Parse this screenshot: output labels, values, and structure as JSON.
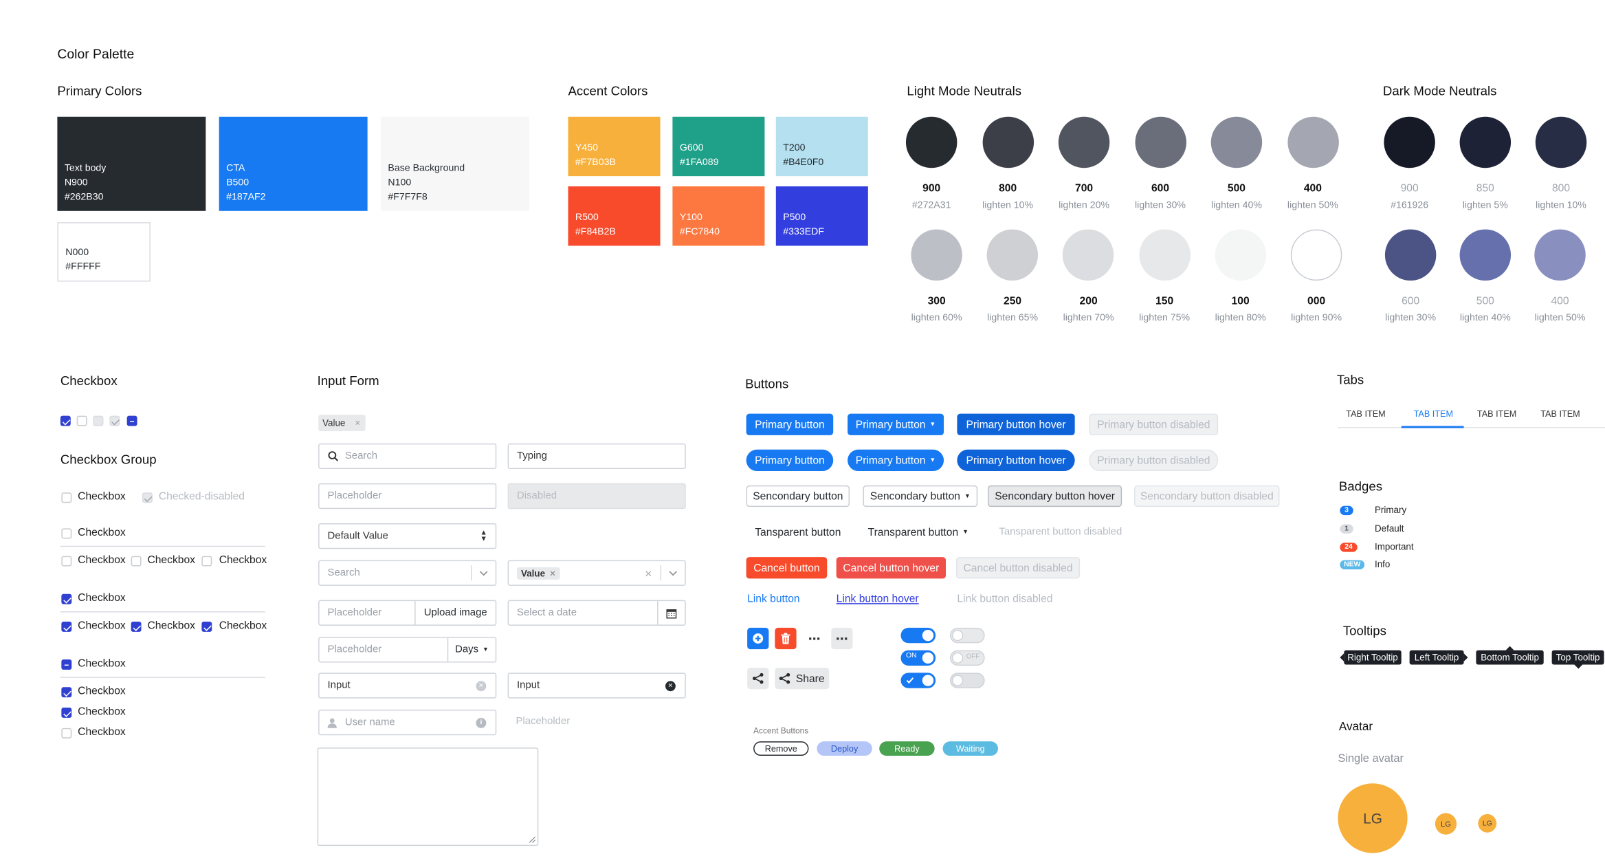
{
  "palette_title": "Color Palette",
  "primary": {
    "title": "Primary Colors",
    "swatches": [
      {
        "name": "Text body",
        "code": "N900",
        "hex": "#262B30"
      },
      {
        "name": "CTA",
        "code": "B500",
        "hex": "#187AF2"
      },
      {
        "name": "Base Background",
        "code": "N100",
        "hex": "#F7F7F8"
      },
      {
        "name": "",
        "code": "N000",
        "hex": "#FFFFF"
      }
    ]
  },
  "accent": {
    "title": "Accent Colors",
    "swatches": [
      {
        "code": "Y450",
        "hex": "#F7B03B"
      },
      {
        "code": "G600",
        "hex": "#1FA089"
      },
      {
        "code": "T200",
        "hex": "#B4E0F0"
      },
      {
        "code": "R500",
        "hex": "#F84B2B"
      },
      {
        "code": "Y100",
        "hex": "#FC7840"
      },
      {
        "code": "P500",
        "hex": "#333EDF"
      }
    ]
  },
  "light_neutrals": {
    "title": "Light Mode Neutrals",
    "items": [
      {
        "label": "900",
        "sub": "#272A31",
        "color": "#262B30"
      },
      {
        "label": "800",
        "sub": "lighten 10%",
        "color": "#3C3F47"
      },
      {
        "label": "700",
        "sub": "lighten 20%",
        "color": "#51555F"
      },
      {
        "label": "600",
        "sub": "lighten 30%",
        "color": "#6A6E7A"
      },
      {
        "label": "500",
        "sub": "lighten 40%",
        "color": "#878B99"
      },
      {
        "label": "400",
        "sub": "lighten 50%",
        "color": "#A4A7B1"
      },
      {
        "label": "300",
        "sub": "lighten 60%",
        "color": "#BDBFC6"
      },
      {
        "label": "250",
        "sub": "lighten 65%",
        "color": "#CFD0D4"
      },
      {
        "label": "200",
        "sub": "lighten 70%",
        "color": "#DCDDE0"
      },
      {
        "label": "150",
        "sub": "lighten 75%",
        "color": "#E7E8EA"
      },
      {
        "label": "100",
        "sub": "lighten 80%",
        "color": "#F4F5F5"
      },
      {
        "label": "000",
        "sub": "lighten 90%",
        "color": "#FFFFFF"
      }
    ]
  },
  "dark_neutrals": {
    "title": "Dark Mode Neutrals",
    "items": [
      {
        "label": "900",
        "sub": "#161926",
        "color": "#161926"
      },
      {
        "label": "850",
        "sub": "lighten 5%",
        "color": "#1D2237"
      },
      {
        "label": "800",
        "sub": "lighten 10%",
        "color": "#272D45"
      },
      {
        "label": "600",
        "sub": "lighten 30%",
        "color": "#4B5485"
      },
      {
        "label": "500",
        "sub": "lighten 40%",
        "color": "#6670AD"
      },
      {
        "label": "400",
        "sub": "lighten 50%",
        "color": "#8990C0"
      }
    ]
  },
  "checkbox": {
    "title": "Checkbox",
    "group_title": "Checkbox Group",
    "label": "Checkbox",
    "checked_disabled": "Checked-disabled"
  },
  "input_form": {
    "title": "Input Form",
    "tag_value": "Value",
    "search_ph": "Search",
    "typing": "Typing",
    "placeholder": "Placeholder",
    "disabled": "Disabled",
    "default_value": "Default Value",
    "value_tag": "Value",
    "upload": "Upload image",
    "date_ph": "Select a date",
    "days": "Days",
    "input": "Input",
    "username": "User name"
  },
  "buttons": {
    "title": "Buttons",
    "primary": "Primary button",
    "primary_hover": "Primary button hover",
    "primary_disabled": "Primary button disabled",
    "secondary": "Sencondary button",
    "secondary_hover": "Sencondary button hover",
    "secondary_disabled": "Sencondary button disabled",
    "transparent": "Tansparent button",
    "transparent_dd": "Transparent button",
    "transparent_disabled": "Tansparent button disabled",
    "cancel": "Cancel button",
    "cancel_hover": "Cancel button hover",
    "cancel_disabled": "Cancel button disabled",
    "link": "Link button",
    "link_hover": "Link button hover",
    "link_disabled": "Link button disabled",
    "share": "Share",
    "toggle_on": "ON",
    "toggle_off": "OFF",
    "accent_title": "Accent Buttons",
    "accent": [
      "Remove",
      "Deploy",
      "Ready",
      "Waiting"
    ]
  },
  "tabs": {
    "title": "Tabs",
    "items": [
      "TAB ITEM",
      "TAB ITEM",
      "TAB ITEM",
      "TAB ITEM"
    ],
    "active_index": 1
  },
  "badges": {
    "title": "Badges",
    "items": [
      {
        "count": "3",
        "label": "Primary",
        "color": "#187AF2"
      },
      {
        "count": "1",
        "label": "Default",
        "color": "#d8dbe0"
      },
      {
        "count": "24",
        "label": "Important",
        "color": "#F84B2B"
      },
      {
        "count": "NEW",
        "label": "Info",
        "color": "#5bb8e8"
      }
    ]
  },
  "tooltips": {
    "title": "Tooltips",
    "items": [
      "Right Tooltip",
      "Left Tooltip",
      "Bottom Tooltip",
      "Top Tooltip"
    ]
  },
  "avatar": {
    "title": "Avatar",
    "subtitle": "Single avatar",
    "initials": "LG"
  }
}
